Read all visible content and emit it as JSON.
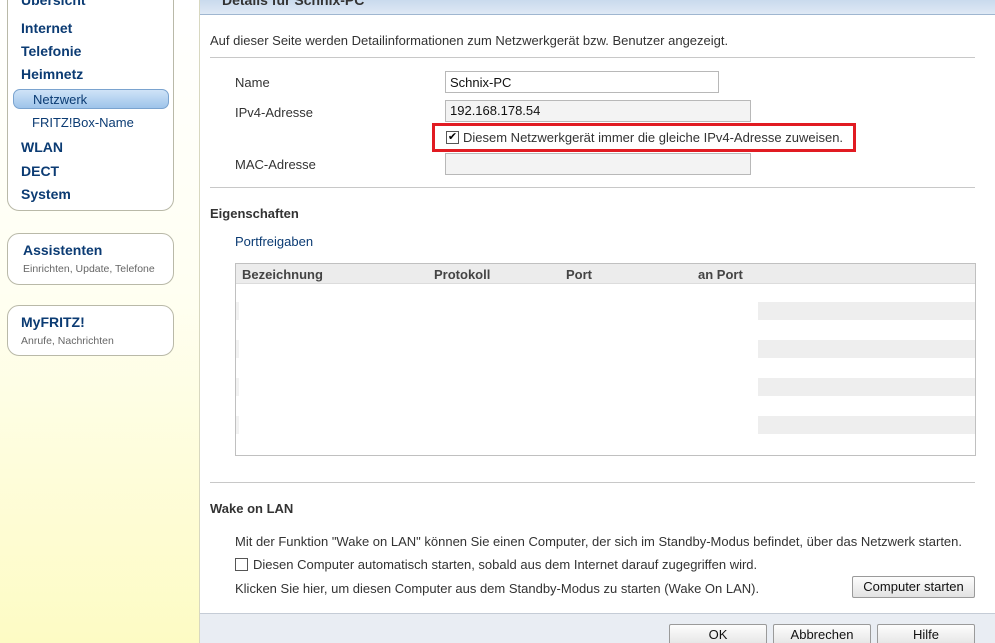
{
  "nav": {
    "items": [
      {
        "label": "Übersicht"
      },
      {
        "label": "Internet"
      },
      {
        "label": "Telefonie"
      },
      {
        "label": "Heimnetz"
      },
      {
        "label": "Netzwerk"
      },
      {
        "label": "FRITZ!Box-Name"
      },
      {
        "label": "WLAN"
      },
      {
        "label": "DECT"
      },
      {
        "label": "System"
      }
    ],
    "assistants": {
      "title": "Assistenten",
      "subtitle": "Einrichten, Update, Telefone"
    },
    "myfritz": {
      "title": "MyFRITZ!",
      "subtitle": "Anrufe, Nachrichten"
    }
  },
  "panel": {
    "title": "Details für Schnix-PC",
    "intro": "Auf dieser Seite werden Detailinformationen zum Netzwerkgerät bzw. Benutzer angezeigt."
  },
  "details": {
    "name_label": "Name",
    "name_value": "Schnix-PC",
    "ipv4_label": "IPv4-Adresse",
    "ipv4_value": "192.168.178.54",
    "same_ip_label": "Diesem Netzwerkgerät immer die gleiche IPv4-Adresse zuweisen.",
    "same_ip_checked": true,
    "mac_label": "MAC-Adresse",
    "mac_value": ""
  },
  "properties": {
    "title": "Eigenschaften",
    "port_link": "Portfreigaben",
    "columns": [
      "Bezeichnung",
      "Protokoll",
      "Port",
      "an Port"
    ]
  },
  "wol": {
    "title": "Wake on LAN",
    "description": "Mit der Funktion \"Wake on LAN\" können Sie einen Computer, der sich im Standby-Modus befindet, über das Netzwerk starten.",
    "auto_start_label": "Diesen Computer automatisch starten, sobald aus dem Internet darauf zugegriffen wird.",
    "auto_start_checked": false,
    "manual_text": "Klicken Sie hier, um diesen Computer aus dem Standby-Modus zu starten (Wake On LAN).",
    "start_button": "Computer starten"
  },
  "footer": {
    "ok": "OK",
    "cancel": "Abbrechen",
    "help": "Hilfe"
  },
  "colors": {
    "accent": "#0b3b73",
    "highlight": "#e11b22"
  }
}
